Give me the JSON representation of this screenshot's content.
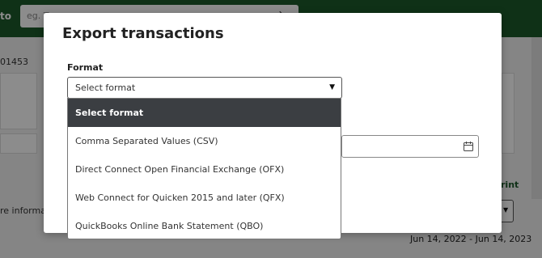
{
  "background": {
    "goto_label": "to",
    "search_placeholder": "eg. T",
    "account_number": "01453",
    "more_info": "re information",
    "print_label": "rint",
    "date_range": "Jun 14, 2022 - Jun 14, 2023"
  },
  "modal": {
    "title": "Export transactions",
    "format_label": "Format",
    "format_select_value": "Select format",
    "format_options": [
      "Select format",
      "Comma Separated Values (CSV)",
      "Direct Connect Open Financial Exchange (OFX)",
      "Web Connect for Quicken 2015 and later (QFX)",
      "QuickBooks Online Bank Statement (QBO)"
    ],
    "selected_index": 0
  },
  "icons": {
    "search": "search-icon",
    "dropdown_arrow": "chevron-down-icon",
    "calendar": "calendar-icon"
  },
  "colors": {
    "header_green": "#1d5a2b",
    "selected_item_bg": "#3b3e42",
    "modal_bg": "#ffffff"
  }
}
